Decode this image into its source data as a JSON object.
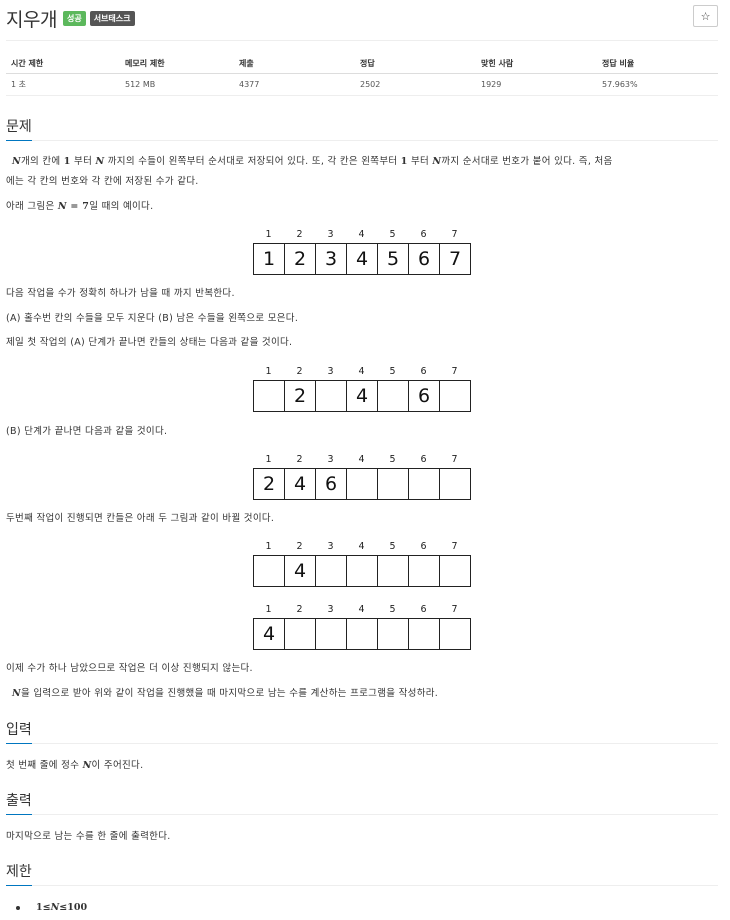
{
  "header": {
    "title": "지우개",
    "badge_success": "성공",
    "badge_subtask": "서브태스크",
    "star": "☆"
  },
  "info_table": {
    "headers": [
      "시간 제한",
      "메모리 제한",
      "제출",
      "정답",
      "맞힌 사람",
      "정답 비율"
    ],
    "values": [
      "1 초",
      "512 MB",
      "4377",
      "2502",
      "1929",
      "57.963%"
    ]
  },
  "sections": {
    "problem": "문제",
    "input": "입력",
    "output": "출력",
    "limit": "제한"
  },
  "problem": {
    "line1_a": "개의 칸에 ",
    "line1_one": "1",
    "line1_b": " 부터 ",
    "line1_c": " 까지의 수들이 왼쪽부터 순서대로 저장되어 있다. 또, 각 칸은 왼쪽부터 ",
    "line1_d": " 부터 ",
    "line1_e": "까지 순서대로 번호가 붙어 있다. 즉, 처음",
    "line2": "에는 각 칸의 번호와 각 칸에 저장된 수가 같다.",
    "line3_a": "아래 그림은 ",
    "line3_eq": " = 7",
    "line3_b": "일 때의 예이다.",
    "line4": "다음 작업을 수가 정확히 하나가 남을 때 까지 반복한다.",
    "line5": "(A) 홀수번 칸의 수들을 모두 지운다 (B) 남은 수들을 왼쪽으로 모은다.",
    "line6": "제일 첫 작업의 (A) 단계가 끝나면 칸들의 상태는 다음과 같을 것이다.",
    "line7": "(B) 단계가 끝나면 다음과 같을 것이다.",
    "line8": "두번째 작업이 진행되면 칸들은 아래 두 그림과 같이 바뀔 것이다.",
    "line9": "이제 수가 하나 남았으므로 작업은 더 이상 진행되지 않는다.",
    "line10": "을 입력으로 받아 위와 같이 작업을 진행했을 때 마지막으로 남는 수를 계산하는 프로그램을 작성하라.",
    "var_n": "N"
  },
  "figures": {
    "indices": [
      "1",
      "2",
      "3",
      "4",
      "5",
      "6",
      "7"
    ],
    "fig1": [
      "1",
      "2",
      "3",
      "4",
      "5",
      "6",
      "7"
    ],
    "fig2": [
      "",
      "2",
      "",
      "4",
      "",
      "6",
      ""
    ],
    "fig3": [
      "2",
      "4",
      "6",
      "",
      "",
      "",
      ""
    ],
    "fig4": [
      "",
      "4",
      "",
      "",
      "",
      "",
      ""
    ],
    "fig5": [
      "4",
      "",
      "",
      "",
      "",
      "",
      ""
    ]
  },
  "input": {
    "text_a": "첫 번째 줄에 정수 ",
    "text_b": "이 주어진다."
  },
  "output": {
    "text": "마지막으로 남는 수를 한 줄에 출력한다."
  },
  "limit": {
    "low": "1",
    "rel": " ≤ ",
    "high": "100"
  }
}
